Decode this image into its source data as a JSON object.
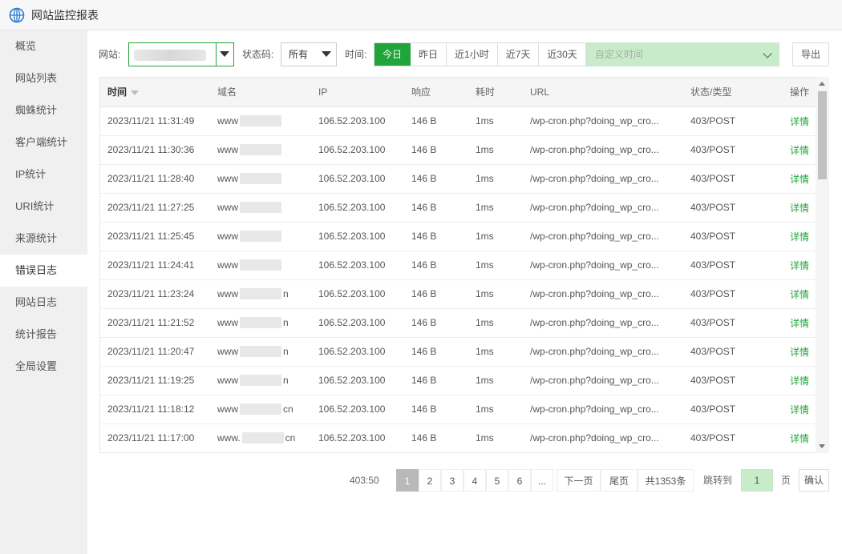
{
  "window": {
    "title": "网站监控报表",
    "icon": "globe-logo-icon"
  },
  "sidebar": {
    "items": [
      {
        "label": "概览",
        "active": false
      },
      {
        "label": "网站列表",
        "active": false
      },
      {
        "label": "蜘蛛统计",
        "active": false
      },
      {
        "label": "客户端统计",
        "active": false
      },
      {
        "label": "IP统计",
        "active": false
      },
      {
        "label": "URI统计",
        "active": false
      },
      {
        "label": "来源统计",
        "active": false
      },
      {
        "label": "错误日志",
        "active": true
      },
      {
        "label": "网站日志",
        "active": false
      },
      {
        "label": "统计报告",
        "active": false
      },
      {
        "label": "全局设置",
        "active": false
      }
    ]
  },
  "toolbar": {
    "site_label": "网站:",
    "status_label": "状态码:",
    "status_value": "所有",
    "time_label": "时间:",
    "time_buttons": [
      "今日",
      "昨日",
      "近1小时",
      "近7天",
      "近30天"
    ],
    "active_time": "今日",
    "custom_time_placeholder": "自定义时间",
    "export_label": "导出"
  },
  "table": {
    "columns": [
      "时间",
      "域名",
      "IP",
      "响应",
      "耗时",
      "URL",
      "状态/类型",
      "操作"
    ],
    "rows": [
      {
        "time": "2023/11/21 11:31:49",
        "domain_prefix": "www",
        "domain_suffix": "",
        "ip": "106.52.203.100",
        "resp": "146 B",
        "dur": "1ms",
        "url": "/wp-cron.php?doing_wp_cro...",
        "status": "403/POST",
        "op": "详情"
      },
      {
        "time": "2023/11/21 11:30:36",
        "domain_prefix": "www",
        "domain_suffix": "",
        "ip": "106.52.203.100",
        "resp": "146 B",
        "dur": "1ms",
        "url": "/wp-cron.php?doing_wp_cro...",
        "status": "403/POST",
        "op": "详情"
      },
      {
        "time": "2023/11/21 11:28:40",
        "domain_prefix": "www",
        "domain_suffix": "",
        "ip": "106.52.203.100",
        "resp": "146 B",
        "dur": "1ms",
        "url": "/wp-cron.php?doing_wp_cro...",
        "status": "403/POST",
        "op": "详情"
      },
      {
        "time": "2023/11/21 11:27:25",
        "domain_prefix": "www",
        "domain_suffix": "",
        "ip": "106.52.203.100",
        "resp": "146 B",
        "dur": "1ms",
        "url": "/wp-cron.php?doing_wp_cro...",
        "status": "403/POST",
        "op": "详情"
      },
      {
        "time": "2023/11/21 11:25:45",
        "domain_prefix": "www",
        "domain_suffix": "",
        "ip": "106.52.203.100",
        "resp": "146 B",
        "dur": "1ms",
        "url": "/wp-cron.php?doing_wp_cro...",
        "status": "403/POST",
        "op": "详情"
      },
      {
        "time": "2023/11/21 11:24:41",
        "domain_prefix": "www",
        "domain_suffix": "",
        "ip": "106.52.203.100",
        "resp": "146 B",
        "dur": "1ms",
        "url": "/wp-cron.php?doing_wp_cro...",
        "status": "403/POST",
        "op": "详情"
      },
      {
        "time": "2023/11/21 11:23:24",
        "domain_prefix": "www",
        "domain_suffix": "n",
        "ip": "106.52.203.100",
        "resp": "146 B",
        "dur": "1ms",
        "url": "/wp-cron.php?doing_wp_cro...",
        "status": "403/POST",
        "op": "详情"
      },
      {
        "time": "2023/11/21 11:21:52",
        "domain_prefix": "www",
        "domain_suffix": "n",
        "ip": "106.52.203.100",
        "resp": "146 B",
        "dur": "1ms",
        "url": "/wp-cron.php?doing_wp_cro...",
        "status": "403/POST",
        "op": "详情"
      },
      {
        "time": "2023/11/21 11:20:47",
        "domain_prefix": "www",
        "domain_suffix": "n",
        "ip": "106.52.203.100",
        "resp": "146 B",
        "dur": "1ms",
        "url": "/wp-cron.php?doing_wp_cro...",
        "status": "403/POST",
        "op": "详情"
      },
      {
        "time": "2023/11/21 11:19:25",
        "domain_prefix": "www",
        "domain_suffix": "n",
        "ip": "106.52.203.100",
        "resp": "146 B",
        "dur": "1ms",
        "url": "/wp-cron.php?doing_wp_cro...",
        "status": "403/POST",
        "op": "详情"
      },
      {
        "time": "2023/11/21 11:18:12",
        "domain_prefix": "www",
        "domain_suffix": "cn",
        "ip": "106.52.203.100",
        "resp": "146 B",
        "dur": "1ms",
        "url": "/wp-cron.php?doing_wp_cro...",
        "status": "403/POST",
        "op": "详情"
      },
      {
        "time": "2023/11/21 11:17:00",
        "domain_prefix": "www.",
        "domain_suffix": "cn",
        "ip": "106.52.203.100",
        "resp": "146 B",
        "dur": "1ms",
        "url": "/wp-cron.php?doing_wp_cro...",
        "status": "403/POST",
        "op": "详情"
      }
    ]
  },
  "pager": {
    "info": "403:50",
    "pages": [
      "1",
      "2",
      "3",
      "4",
      "5",
      "6",
      "..."
    ],
    "current": "1",
    "next": "下一页",
    "last": "尾页",
    "total": "共1353条",
    "jump_label": "跳转到",
    "jump_value": "1",
    "page_unit": "页",
    "confirm": "确认"
  },
  "colors": {
    "accent": "#20a53a",
    "accent_light": "#c8ecca"
  }
}
